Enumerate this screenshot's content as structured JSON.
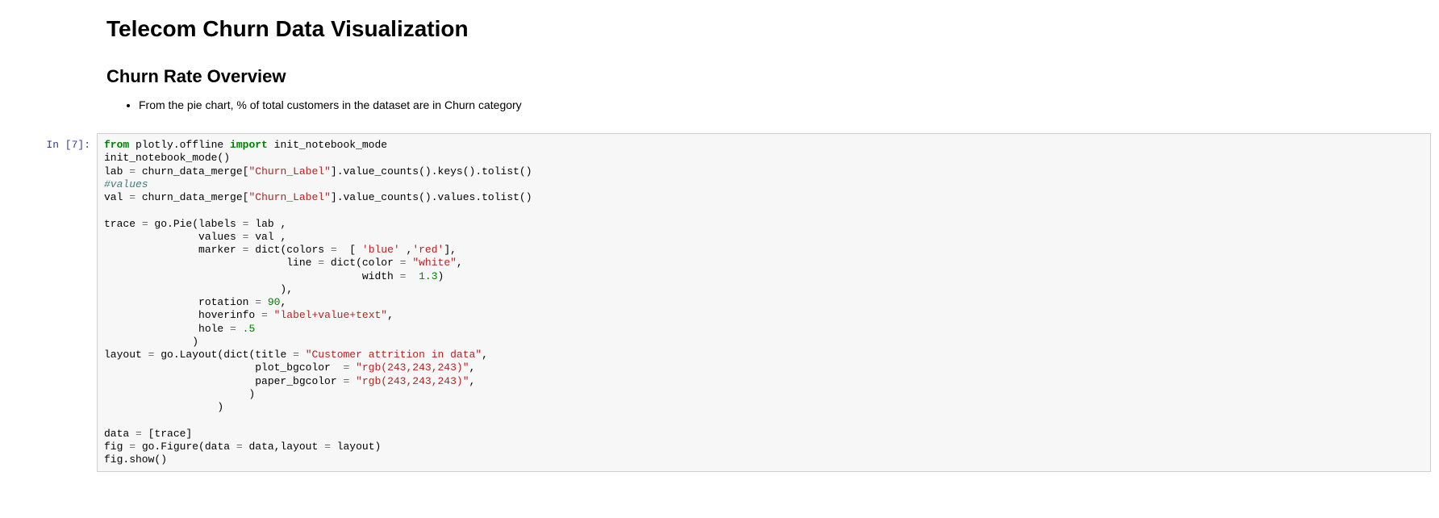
{
  "heading1": "Telecom Churn Data Visualization",
  "heading2": "Churn Rate Overview",
  "bullet1": "From the pie chart, % of total customers in the dataset are in Churn category",
  "prompt": "In [7]:",
  "code": {
    "kw_from": "from",
    "mod": " plotly.offline ",
    "kw_import": "import",
    "imp_name": " init_notebook_mode",
    "l2": "init_notebook_mode()",
    "l3a": "lab ",
    "op_eq": "=",
    "l3b": " churn_data_merge[",
    "str_churn": "\"Churn_Label\"",
    "l3c": "].value_counts().keys().tolist()",
    "com_values": "#values",
    "l5a": "val ",
    "l5b": " churn_data_merge[",
    "l5c": "].value_counts().values.tolist()",
    "l7a": "trace ",
    "l7b": " go.Pie(labels ",
    "l7c": " lab ,",
    "l8a": "               values ",
    "l8b": " val ,",
    "l9a": "               marker ",
    "l9b": " dict(colors ",
    "l9c": "  [ ",
    "str_blue": "'blue'",
    "l9d": " ,",
    "str_red": "'red'",
    "l9e": "],",
    "l10a": "                             line ",
    "l10b": " dict(color ",
    "str_white": "\"white\"",
    "l10c": ",",
    "l11a": "                                         width ",
    "num_13": "1.3",
    "l11b": ")",
    "l12": "                            ),",
    "l13a": "               rotation ",
    "num_90": "90",
    "l13b": ",",
    "l14a": "               hoverinfo ",
    "str_hover": "\"label+value+text\"",
    "l14b": ",",
    "l15a": "               hole ",
    "num_5": ".5",
    "l16": "              )",
    "l17a": "layout ",
    "l17b": " go.Layout(dict(title ",
    "str_title": "\"Customer attrition in data\"",
    "l17c": ",",
    "l18a": "                        plot_bgcolor  ",
    "str_rgb": "\"rgb(243,243,243)\"",
    "l18b": ",",
    "l19a": "                        paper_bgcolor ",
    "l19b": ",",
    "l20": "                       )",
    "l21": "                  )",
    "l23a": "data ",
    "l23b": " [trace]",
    "l24a": "fig ",
    "l24b": " go.Figure(data ",
    "l24c": " data,layout ",
    "l24d": " layout)",
    "l25": "fig.show()"
  }
}
